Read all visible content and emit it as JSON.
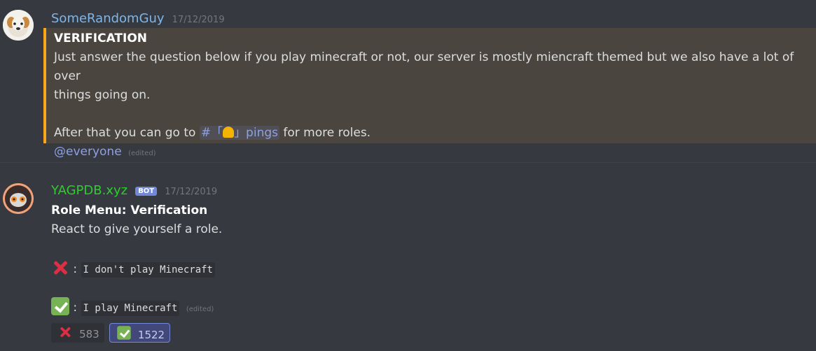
{
  "messages": [
    {
      "username": "SomeRandomGuy",
      "timestamp": "17/12/2019",
      "title": "VERIFICATION",
      "line1": "Just answer the question below if you play minecraft or not, our server is mostly miencraft themed but we also have a lot of over",
      "line2": "things going on.",
      "line3_pre": "After that you can go to",
      "channel_prefix": "#「",
      "channel_suffix": "」pings",
      "line3_post": "for more roles.",
      "mention": "@everyone",
      "edited": "(edited)",
      "channel_icon": "bell-icon",
      "highlight_color": "#faa61a"
    },
    {
      "username": "YAGPDB.xyz",
      "bot_tag": "BOT",
      "timestamp": "17/12/2019",
      "title": "Role Menu: Verification",
      "subtitle": "React to give yourself a role.",
      "options": [
        {
          "icon": "cross-mark-icon",
          "colon": ":",
          "label": "I don't play Minecraft"
        },
        {
          "icon": "check-mark-icon",
          "colon": ":",
          "label": "I play Minecraft",
          "edited": "(edited)"
        }
      ],
      "reactions": [
        {
          "icon": "cross-mark-icon",
          "count": "583"
        },
        {
          "icon": "check-mark-icon",
          "count": "1522"
        }
      ]
    }
  ]
}
